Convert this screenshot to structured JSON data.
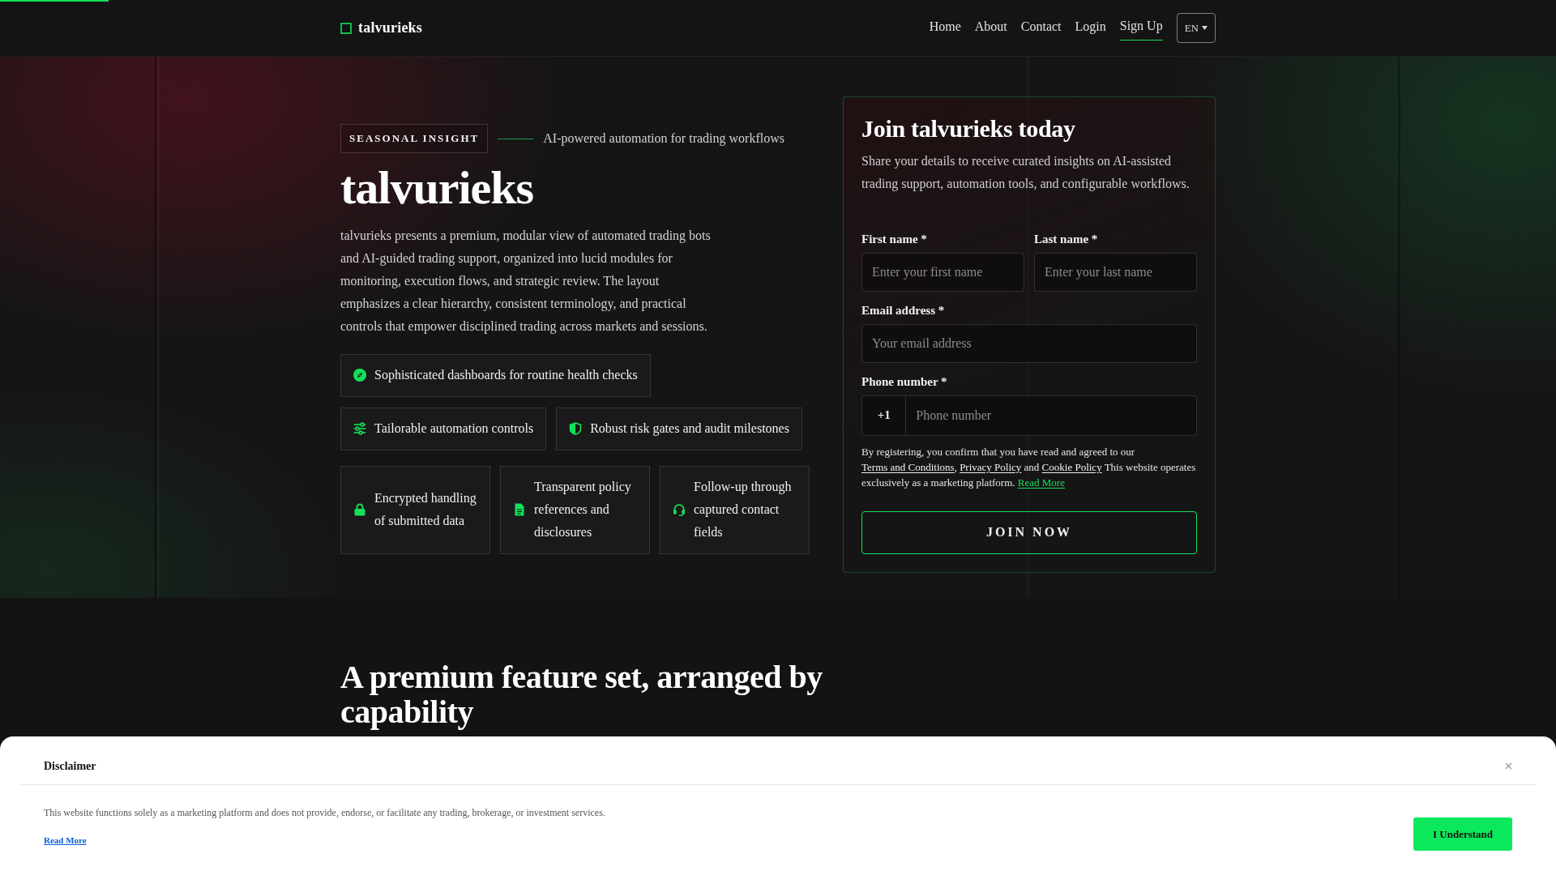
{
  "progress": {
    "level": 0.07
  },
  "header": {
    "brand": "talvurieks",
    "nav": [
      {
        "label": "Home",
        "selected": false
      },
      {
        "label": "About",
        "selected": false
      },
      {
        "label": "Contact",
        "selected": false
      },
      {
        "label": "Login",
        "selected": false
      },
      {
        "label": "Sign Up",
        "selected": true
      }
    ],
    "language": "EN"
  },
  "hero": {
    "badge": "SEASONAL INSIGHT",
    "tagline": "AI-powered automation for trading workflows",
    "title": "talvurieks",
    "description": "talvurieks presents a premium, modular view of automated trading bots and AI-guided trading support, organized into lucid modules for monitoring, execution flows, and strategic review. The layout emphasizes a clear hierarchy, consistent terminology, and practical controls that empower disciplined trading across markets and sessions.",
    "highlights": [
      {
        "kind": "chips",
        "items": [
          "Sophisticated dashboards for routine health checks"
        ]
      },
      {
        "kind": "chips",
        "items": [
          "Tailorable automation controls",
          "Robust risk gates and audit milestones"
        ]
      },
      {
        "kind": "cards",
        "items": [
          "Encrypted handling of submitted data",
          "Transparent policy references and disclosures",
          "Follow-up through captured contact fields"
        ]
      }
    ]
  },
  "signup_form": {
    "title": "Join talvurieks today",
    "intro": "Share your details to receive curated insights on AI-assisted trading support, automation tools, and configurable workflows.",
    "fields": [
      {
        "kind": "half",
        "label": "First name *",
        "placeholder": "Enter your first name"
      },
      {
        "kind": "half",
        "label": "Last name *",
        "placeholder": "Enter your last name"
      },
      {
        "kind": "full",
        "label": "Email address *",
        "placeholder": "Your email address"
      },
      {
        "kind": "phone",
        "label": "Phone number *",
        "prefix": "+1",
        "placeholder": "Phone number"
      }
    ],
    "consent": [
      {
        "kind": "text",
        "text": "By registering, you confirm that you have read and agreed to our "
      },
      {
        "kind": "link",
        "text": "Terms and Conditions"
      },
      {
        "kind": "text",
        "text": ", "
      },
      {
        "kind": "link",
        "text": "Privacy Policy"
      },
      {
        "kind": "text",
        "text": " and "
      },
      {
        "kind": "link",
        "text": "Cookie Policy"
      },
      {
        "kind": "text",
        "text": " This website operates exclusively as a marketing platform. "
      },
      {
        "kind": "accent_link",
        "text": "Read More"
      }
    ],
    "submit": "JOIN NOW"
  },
  "features_section": {
    "title": "A premium feature set, arranged by capability"
  },
  "disclaimer": {
    "title": "Disclaimer",
    "text": "This website functions solely as a marketing platform and does not provide, endorse, or facilitate any trading, brokerage, or investment services.",
    "link": "Read More",
    "button": "I Understand"
  }
}
